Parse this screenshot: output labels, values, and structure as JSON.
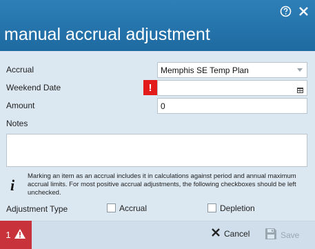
{
  "dialog": {
    "title": "manual accrual adjustment"
  },
  "header_icons": {
    "help": "question-circle-icon",
    "close": "close-icon"
  },
  "form": {
    "accrual_label": "Accrual",
    "accrual_value": "Memphis SE Temp Plan",
    "weekend_date_label": "Weekend Date",
    "weekend_date_value": "",
    "weekend_date_error_mark": "!",
    "amount_label": "Amount",
    "amount_value": "0",
    "notes_label": "Notes",
    "notes_value": ""
  },
  "info": {
    "icon": "i",
    "text": "Marking an item as an accrual includes it in calculations against period and annual maximum accrual limits.  For most positive accrual adjustments, the following checkboxes should be left unchecked."
  },
  "adjustment": {
    "label": "Adjustment Type",
    "options": [
      {
        "label": "Accrual",
        "checked": false
      },
      {
        "label": "Depletion",
        "checked": false
      }
    ]
  },
  "footer": {
    "error_count": "1",
    "cancel_label": "Cancel",
    "save_label": "Save"
  },
  "colors": {
    "header": "#2376b0",
    "error": "#e31b1b",
    "error_footer": "#c8323a"
  }
}
